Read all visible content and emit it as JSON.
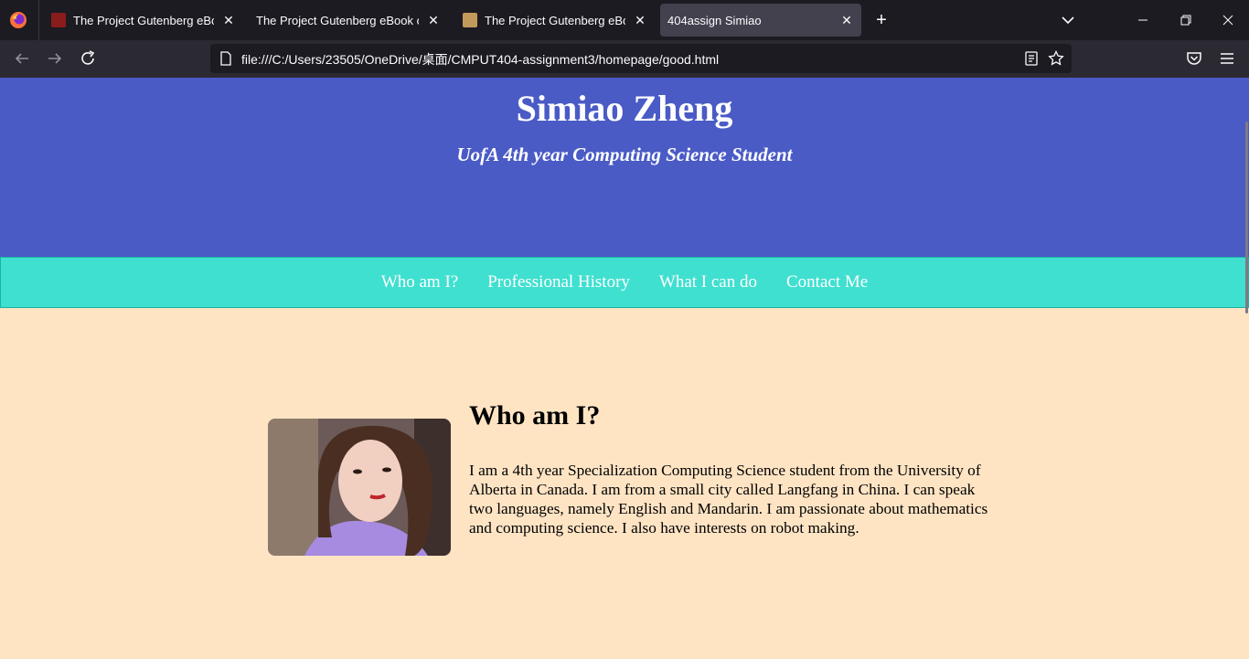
{
  "browser": {
    "tabs": [
      {
        "title": "The Project Gutenberg eBook",
        "favicon": "book-cover-red"
      },
      {
        "title": "The Project Gutenberg eBook of",
        "favicon": "none"
      },
      {
        "title": "The Project Gutenberg eBook",
        "favicon": "book-cover-illustration"
      },
      {
        "title": "404assign Simiao",
        "favicon": "none",
        "active": true
      }
    ],
    "url": "file:///C:/Users/23505/OneDrive/桌面/CMPUT404-assignment3/homepage/good.html",
    "colors": {
      "tabbar": "#1c1b22",
      "toolbar": "#2b2a33",
      "active_tab": "#42414d"
    }
  },
  "page": {
    "name": "Simiao Zheng",
    "subtitle": "UofA 4th year Computing Science Student",
    "nav": [
      "Who am I?",
      "Professional History",
      "What I can do",
      "Contact Me"
    ],
    "about": {
      "heading": "Who am I?",
      "text": "I am a 4th year Specialization Computing Science student from the University of Alberta in Canada. I am from a small city called Langfang in China. I can speak two languages, namely English and Mandarin. I am passionate about mathematics and computing science. I also have interests on robot making."
    },
    "colors": {
      "hero": "#4a5bc6",
      "nav": "#40e0d0",
      "background": "#ffe4c4"
    }
  }
}
